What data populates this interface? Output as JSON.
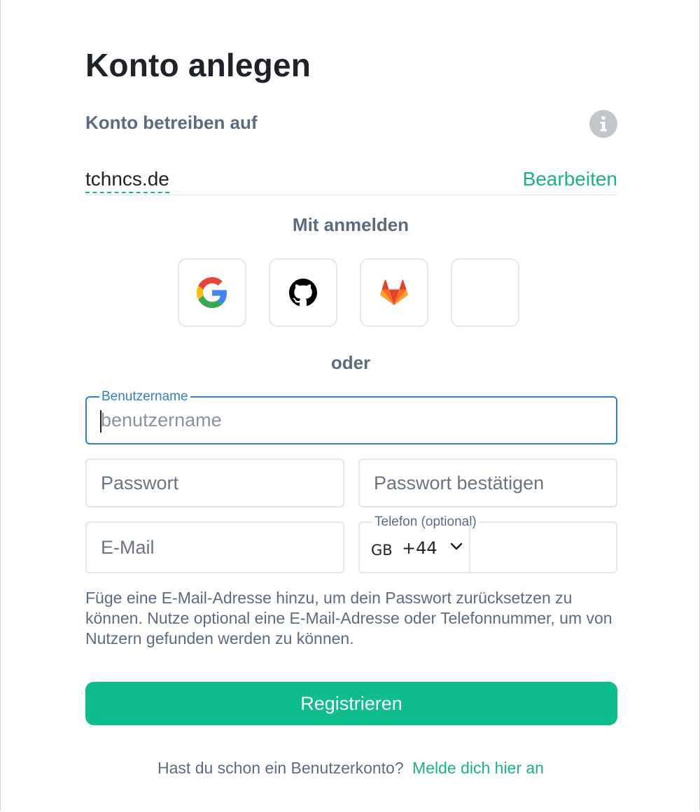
{
  "page": {
    "title": "Konto anlegen"
  },
  "server": {
    "label": "Konto betreiben auf",
    "name": "tchncs.de",
    "edit_label": "Bearbeiten"
  },
  "sso": {
    "label": "Mit anmelden",
    "providers": [
      {
        "name": "Google",
        "icon": "google-icon"
      },
      {
        "name": "GitHub",
        "icon": "github-icon"
      },
      {
        "name": "GitLab",
        "icon": "gitlab-icon"
      },
      {
        "name": "",
        "icon": "blank-icon"
      }
    ]
  },
  "divider": {
    "label": "oder"
  },
  "form": {
    "username": {
      "legend": "Benutzername",
      "placeholder": "benutzername",
      "value": ""
    },
    "password": {
      "placeholder": "Passwort",
      "value": ""
    },
    "password_confirm": {
      "placeholder": "Passwort bestätigen",
      "value": ""
    },
    "email": {
      "placeholder": "E-Mail",
      "value": ""
    },
    "phone": {
      "legend": "Telefon (optional)",
      "country_code": "GB",
      "dial_code": "+44",
      "value": ""
    },
    "help_text": "Füge eine E-Mail-Adresse hinzu, um dein Passwort zurücksetzen zu können. Nutze optional eine E-Mail-Adresse oder Telefonnummer, um von Nutzern gefunden werden zu können.",
    "submit_label": "Registrieren"
  },
  "footer": {
    "question": "Hast du schon ein Benutzerkonto?",
    "login_link": "Melde dich hier an"
  },
  "colors": {
    "accent": "#0dbd8b",
    "link": "#17b384",
    "focus": "#2f7fcb",
    "muted_text": "#5b6b82",
    "heading": "#1f2329"
  }
}
